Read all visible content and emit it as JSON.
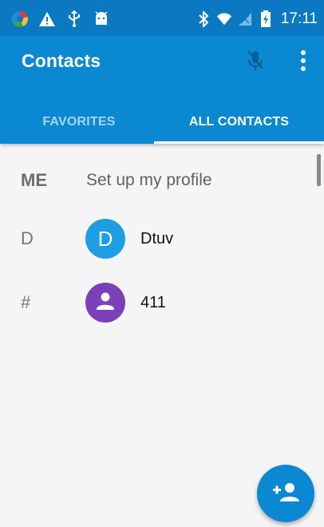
{
  "status_bar": {
    "time": "17:11",
    "left_icons": [
      "color-circle-icon",
      "alert-icon",
      "usb-icon",
      "android-icon"
    ],
    "right_icons": [
      "bluetooth-icon",
      "wifi-icon",
      "no-signal-icon",
      "battery-charging-icon"
    ]
  },
  "app_bar": {
    "title": "Contacts",
    "color": "#0a88d2",
    "status_color": "#0a79c2",
    "actions": [
      "mic-off-icon",
      "overflow-menu-icon"
    ]
  },
  "tabs": [
    {
      "label": "FAVORITES",
      "selected": false
    },
    {
      "label": "ALL CONTACTS",
      "selected": true
    }
  ],
  "contacts": {
    "me": {
      "section": "ME",
      "label": "Set up my profile"
    },
    "rows": [
      {
        "section": "D",
        "avatar_letter": "D",
        "avatar_color": "#1e9de2",
        "name": "Dtuv"
      },
      {
        "section": "#",
        "avatar_icon": "person-icon",
        "avatar_color": "#7b3fb7",
        "name": "411"
      }
    ]
  },
  "fab": {
    "icon": "add-person-icon",
    "color": "#0a88d2"
  }
}
